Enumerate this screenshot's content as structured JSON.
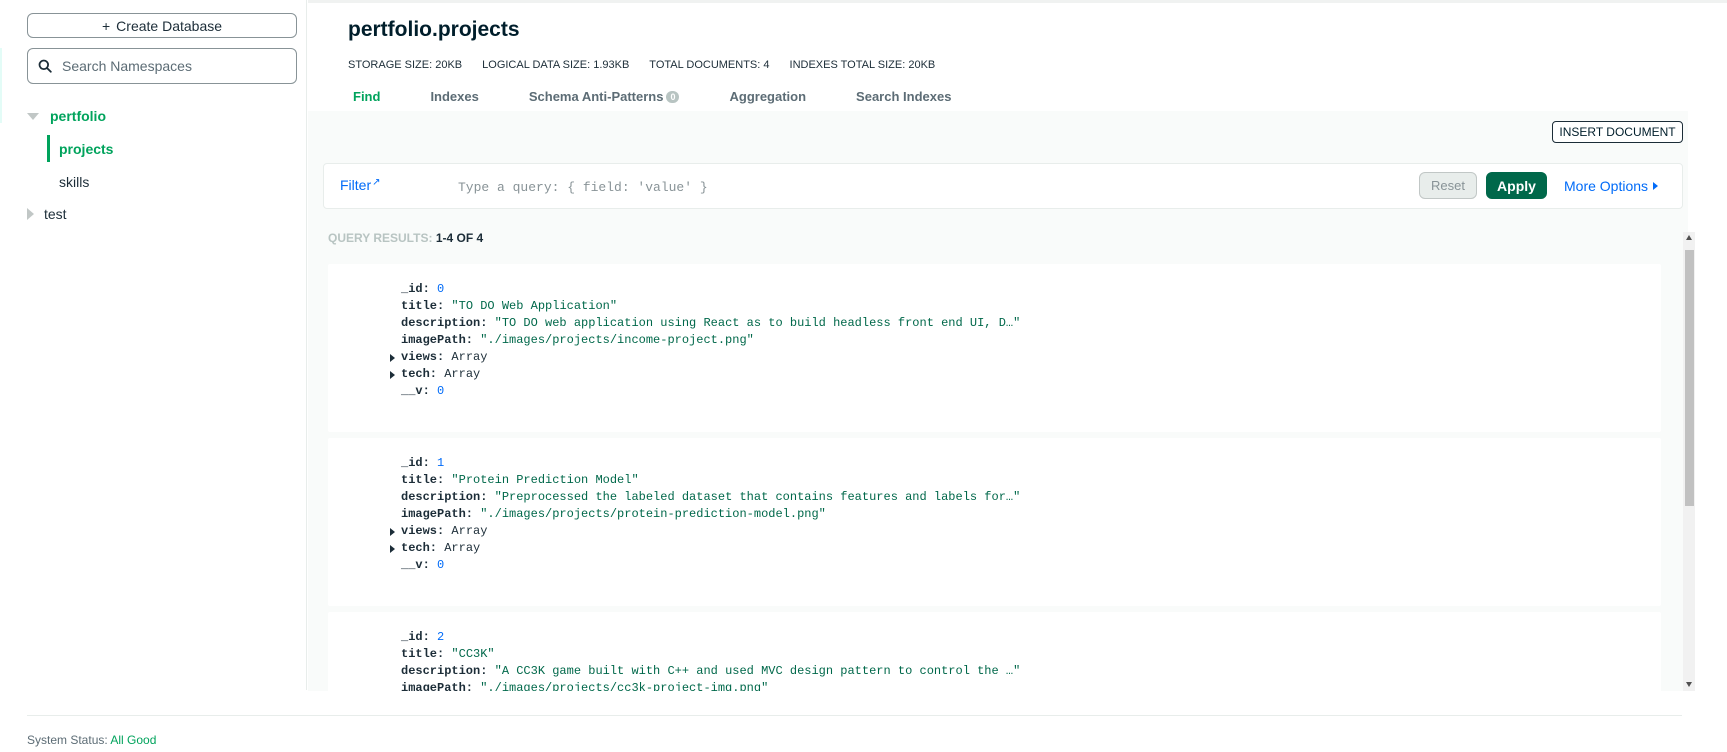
{
  "sidebar": {
    "create_label": "Create Database",
    "search_placeholder": "Search Namespaces",
    "databases": [
      {
        "name": "pertfolio",
        "collections": [
          "projects",
          "skills"
        ]
      },
      {
        "name": "test"
      }
    ]
  },
  "header": {
    "title": "pertfolio.projects",
    "stats": {
      "storage_label": "STORAGE SIZE:",
      "storage_value": "20KB",
      "logical_label": "LOGICAL DATA SIZE:",
      "logical_value": "1.93KB",
      "docs_label": "TOTAL DOCUMENTS:",
      "docs_value": "4",
      "indexes_label": "INDEXES TOTAL SIZE:",
      "indexes_value": "20KB"
    },
    "tabs": {
      "find": "Find",
      "indexes": "Indexes",
      "schema": "Schema Anti-Patterns",
      "schema_count": "0",
      "aggregation": "Aggregation",
      "search_indexes": "Search Indexes"
    }
  },
  "toolbar": {
    "insert_label": "INSERT DOCUMENT",
    "filter_label": "Filter",
    "query_placeholder": "Type a query: { field: 'value' }",
    "reset_label": "Reset",
    "apply_label": "Apply",
    "more_options_label": "More Options"
  },
  "results": {
    "label": "QUERY RESULTS:",
    "range": "1-4 OF 4",
    "documents": [
      {
        "id": "0",
        "title": "\"TO DO Web Application\"",
        "description": "\"TO DO web application using React as to build headless front end UI, D…\"",
        "imagePath": "\"./images/projects/income-project.png\"",
        "views": "Array",
        "tech": "Array",
        "v": "0"
      },
      {
        "id": "1",
        "title": "\"Protein Prediction Model\"",
        "description": "\"Preprocessed the labeled dataset that contains features and labels for…\"",
        "imagePath": "\"./images/projects/protein-prediction-model.png\"",
        "views": "Array",
        "tech": "Array",
        "v": "0"
      },
      {
        "id": "2",
        "title": "\"CC3K\"",
        "description": "\"A CC3K game built with C++ and used MVC design pattern to control the …\"",
        "imagePath": "\"./images/projects/cc3k-project-img.png\""
      }
    ],
    "field_keys": {
      "id": "_id:",
      "title": "title:",
      "description": "description:",
      "imagePath": "imagePath:",
      "views": "views:",
      "tech": "tech:",
      "v": "__v:"
    }
  },
  "footer": {
    "status_label": "System Status:",
    "status_value": "All Good"
  },
  "colors": {
    "accent_green": "#00a35c",
    "apply_green": "#00684a",
    "link_blue": "#016bf8"
  }
}
